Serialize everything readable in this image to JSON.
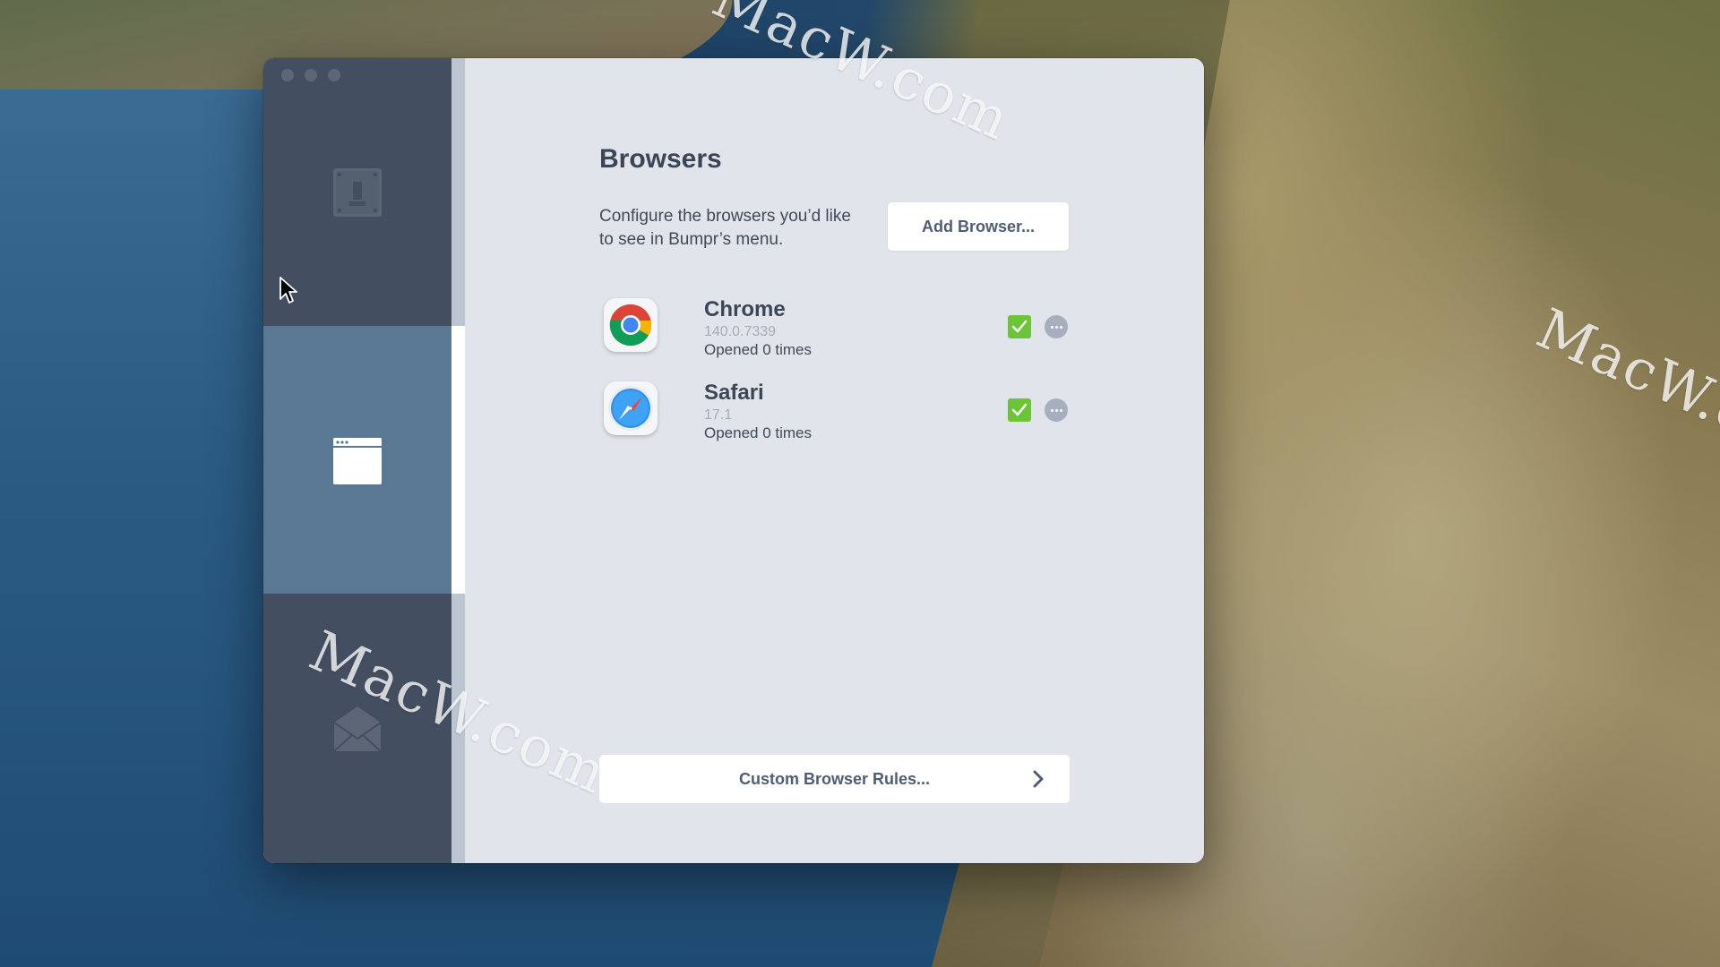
{
  "window": {
    "traffic_lights": [
      "close",
      "minimize",
      "zoom"
    ]
  },
  "sidebar": {
    "tabs": [
      {
        "icon": "general-settings-icon",
        "active": false
      },
      {
        "icon": "browser-window-icon",
        "active": true
      },
      {
        "icon": "mail-envelope-icon",
        "active": false
      }
    ]
  },
  "main": {
    "title": "Browsers",
    "description": "Configure the browsers you’d like to see in Bumpr’s menu.",
    "add_button": "Add Browser...",
    "browsers": [
      {
        "name": "Chrome",
        "version": "140.0.7339",
        "opened": "Opened 0 times",
        "icon": "chrome-icon",
        "enabled": true
      },
      {
        "name": "Safari",
        "version": "17.1",
        "opened": "Opened 0 times",
        "icon": "safari-icon",
        "enabled": true
      }
    ],
    "rules_button": "Custom Browser Rules..."
  },
  "watermark": "MacW.com",
  "colors": {
    "sidebar": "#434e60",
    "sidebar_active": "#5a7894",
    "content_bg": "#e1e4ea",
    "check_green": "#6cc437",
    "text_dark": "#3c4657"
  }
}
